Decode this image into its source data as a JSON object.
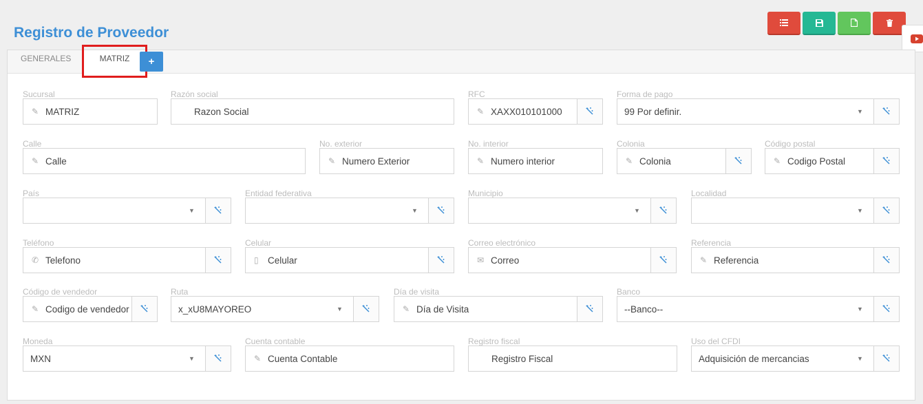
{
  "page": {
    "title": "Registro de Proveedor"
  },
  "colors": {
    "title_blue": "#3d8fd6",
    "danger": "#e04b3c",
    "success_teal": "#25b894",
    "success_green": "#62c65d",
    "highlight": "#e01d1d"
  },
  "toolbar": {
    "buttons": [
      {
        "name": "list-button",
        "icon": "list-icon",
        "color": "#e04b3c"
      },
      {
        "name": "save-button",
        "icon": "save-icon",
        "color": "#25b894"
      },
      {
        "name": "new-document-button",
        "icon": "file-icon",
        "color": "#62c65d"
      },
      {
        "name": "delete-button",
        "icon": "trash-icon",
        "color": "#e04b3c"
      }
    ]
  },
  "tabs": [
    {
      "label": "GENERALES"
    },
    {
      "label": "MATRIZ",
      "active": true
    }
  ],
  "tab_add": {
    "icon": "plus-icon",
    "label": "+"
  },
  "form": {
    "sucursal": {
      "label": "Sucursal",
      "value": "MATRIZ",
      "icon": "edit-icon"
    },
    "razon_social": {
      "label": "Razón social",
      "placeholder": "Razon Social"
    },
    "rfc": {
      "label": "RFC",
      "value": "XAXX010101000",
      "icon": "edit-icon"
    },
    "forma_pago": {
      "label": "Forma de pago",
      "value": "99 Por definir."
    },
    "calle": {
      "label": "Calle",
      "placeholder": "Calle",
      "icon": "edit-icon"
    },
    "no_exterior": {
      "label": "No. exterior",
      "placeholder": "Numero Exterior",
      "icon": "edit-icon"
    },
    "no_interior": {
      "label": "No. interior",
      "placeholder": "Numero interior",
      "icon": "edit-icon"
    },
    "colonia": {
      "label": "Colonia",
      "placeholder": "Colonia",
      "icon": "edit-icon"
    },
    "codigo_postal": {
      "label": "Código postal",
      "placeholder": "Codigo Postal",
      "icon": "edit-icon"
    },
    "pais": {
      "label": "País",
      "value": ""
    },
    "entidad": {
      "label": "Entidad federativa",
      "value": ""
    },
    "municipio": {
      "label": "Municipio",
      "value": ""
    },
    "localidad": {
      "label": "Localidad",
      "value": ""
    },
    "telefono": {
      "label": "Teléfono",
      "placeholder": "Telefono",
      "icon": "phone-icon"
    },
    "celular": {
      "label": "Celular",
      "placeholder": "Celular",
      "icon": "mobile-icon"
    },
    "correo": {
      "label": "Correo electrónico",
      "placeholder": "Correo",
      "icon": "envelope-icon"
    },
    "referencia": {
      "label": "Referencia",
      "placeholder": "Referencia",
      "icon": "edit-icon"
    },
    "codigo_vendedor": {
      "label": "Código de vendedor",
      "placeholder": "Codigo de vendedor",
      "icon": "edit-icon"
    },
    "ruta": {
      "label": "Ruta",
      "value": "x_xU8MAYOREO"
    },
    "dia_visita": {
      "label": "Día de visita",
      "placeholder": "Día de Visita",
      "icon": "edit-icon"
    },
    "banco": {
      "label": "Banco",
      "value": "--Banco--"
    },
    "moneda": {
      "label": "Moneda",
      "value": "MXN"
    },
    "cuenta_contable": {
      "label": "Cuenta contable",
      "placeholder": "Cuenta Contable",
      "icon": "edit-icon"
    },
    "registro_fiscal": {
      "label": "Registro fiscal",
      "placeholder": "Registro Fiscal"
    },
    "uso_cfdi": {
      "label": "Uso del CFDI",
      "value": "Adquisición de mercancias"
    }
  }
}
